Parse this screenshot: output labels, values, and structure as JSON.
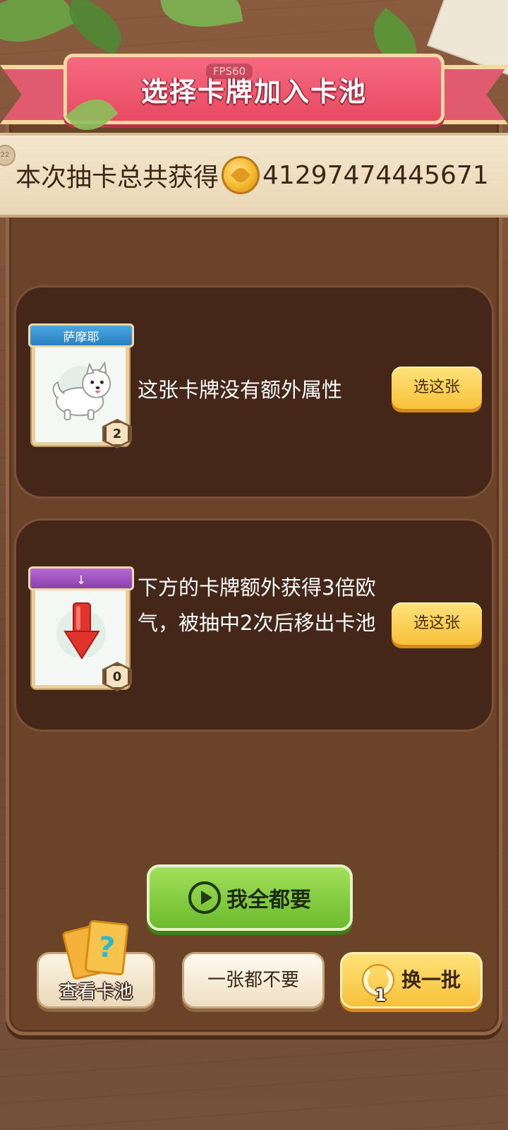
{
  "header": {
    "title": "选择卡牌加入卡池",
    "fps": "FPS60"
  },
  "summary": {
    "label": "本次抽卡总共获得",
    "coin_icon": "clover-coin-icon",
    "value": "41297474445671",
    "side_badge": "22"
  },
  "options": [
    {
      "card_name": "萨摩耶",
      "card_icon": "samoyed-dog-icon",
      "level": "2",
      "description": "这张卡牌没有额外属性",
      "button_label": "选这张"
    },
    {
      "card_name": "↓",
      "card_icon": "down-arrow-icon",
      "level": "0",
      "description": "下方的卡牌额外获得3倍欧气，被抽中2次后移出卡池",
      "button_label": "选这张"
    }
  ],
  "actions": {
    "take_all_label": "我全都要",
    "take_all_icon": "play-video-icon",
    "view_pool_label": "查看卡池",
    "view_pool_icon": "question-cards-icon",
    "none_label": "一张都不要",
    "swap_label": "换一批",
    "swap_icon": "refresh-icon",
    "swap_count": "1"
  },
  "colors": {
    "ribbon": "#e94a63",
    "panel": "#6a4329",
    "option_bg": "#45271a",
    "yellow_button": "#f7c13a",
    "green_button": "#6cbb2e"
  }
}
